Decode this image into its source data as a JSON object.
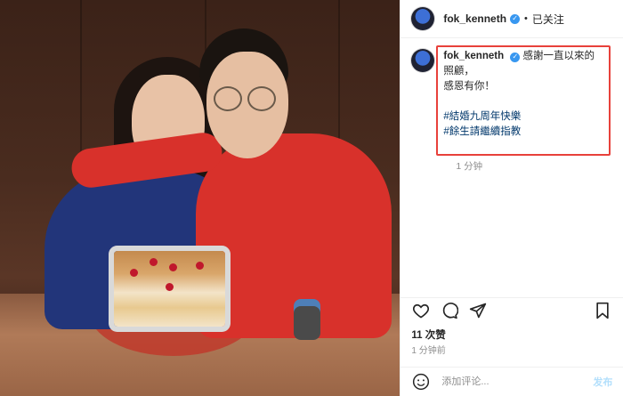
{
  "account": {
    "username": "fok_kenneth",
    "verified_mark": "✓",
    "separator": "•",
    "follow_state": "已关注"
  },
  "caption": {
    "username": "fok_kenneth",
    "line1": "感謝一直以來的照顧，",
    "line2": "感恩有你！",
    "hashtags": [
      "#結婚九周年快樂",
      "#餘生請繼續指教"
    ],
    "time": "1 分钟"
  },
  "engagement": {
    "likes": "11 次赞",
    "time_ago": "1 分钟前"
  },
  "comment": {
    "placeholder": "添加评论...",
    "post_label": "发布"
  },
  "icons": {
    "like": "heart-icon",
    "comment": "comment-icon",
    "share": "share-icon",
    "save": "bookmark-icon",
    "emoji": "emoji-icon"
  },
  "colors": {
    "highlight_border": "#e8413b",
    "hashtag": "#00376b",
    "verified": "#3897f0",
    "sweater": "#d8312b"
  }
}
